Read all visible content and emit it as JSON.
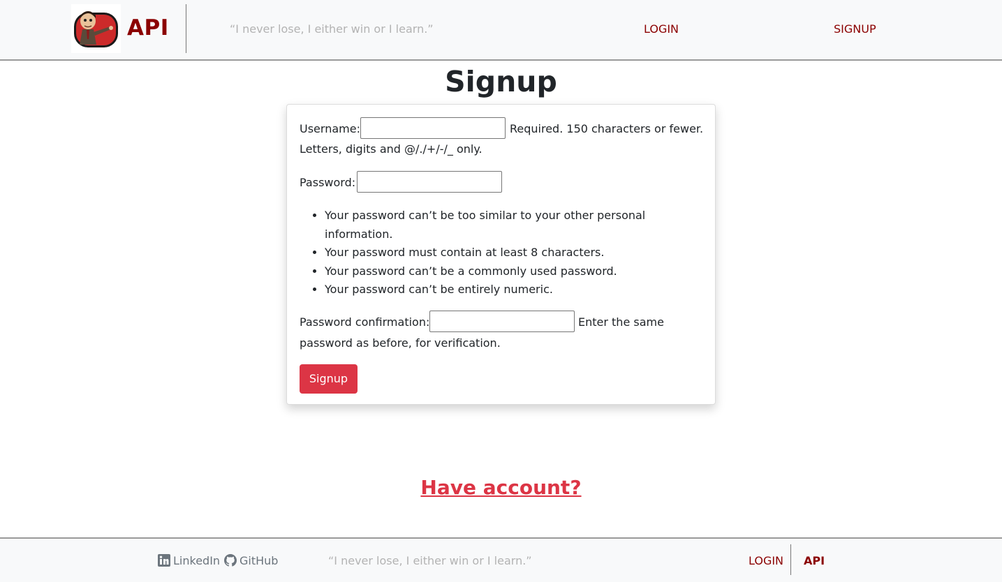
{
  "header": {
    "brand": "API",
    "quote": "“I never lose, I either win or I learn.”",
    "nav": {
      "login": "LOGIN",
      "signup": "SIGNUP"
    }
  },
  "main": {
    "title": "Signup",
    "form": {
      "username_label": "Username:",
      "username_help_1": "Required. 150 characters or fewer.",
      "username_help_2": "Letters, digits and @/./+/-/_ only.",
      "username_value": "",
      "password_label": "Password:",
      "password_value": "",
      "password_rules": [
        "Your password can’t be too similar to your other personal information.",
        "Your password must contain at least 8 characters.",
        "Your password can’t be a commonly used password.",
        "Your password can’t be entirely numeric."
      ],
      "confirm_label": "Password confirmation:",
      "confirm_help_1": "Enter the same",
      "confirm_help_2": "password as before, for verification.",
      "confirm_value": "",
      "submit_label": "Signup"
    },
    "have_account": "Have account?"
  },
  "footer": {
    "linkedin": "LinkedIn",
    "github": "GitHub",
    "quote": "“I never lose, I either win or I learn.”",
    "login": "LOGIN",
    "brand": "API"
  },
  "colors": {
    "brand": "#8b0000",
    "accent": "#dc3545",
    "quote": "#b3b3b3",
    "bar_bg": "#f8f9fa"
  },
  "icons": {
    "logo": "mr-bean-logo",
    "linkedin": "linkedin-icon",
    "github": "github-icon"
  }
}
